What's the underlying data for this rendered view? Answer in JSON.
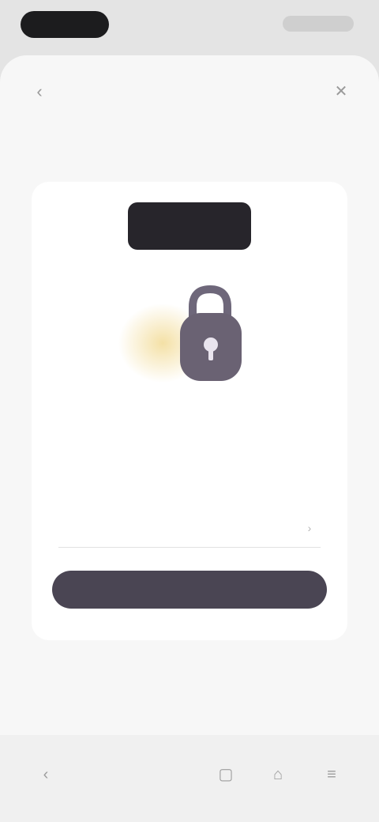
{
  "nav": {
    "title": "",
    "back_icon": "chevron-left-icon",
    "close_icon": "close-icon"
  },
  "card": {
    "wordmark": "",
    "illustration_icon": "lock-illustration",
    "headline": "",
    "subtext_line1": "",
    "subtext_line2": "",
    "subtext_line3": ""
  },
  "form": {
    "label": "",
    "value": "",
    "placeholder": ""
  },
  "actions": {
    "primary_label": ""
  },
  "colors": {
    "accent": "#4a4553",
    "wordmark_bg": "#27252b",
    "illustration_glow": "#f3dd9c"
  },
  "home_bar": {
    "icons": [
      "back-icon",
      "tabs-icon",
      "home-icon",
      "menu-icon"
    ]
  }
}
